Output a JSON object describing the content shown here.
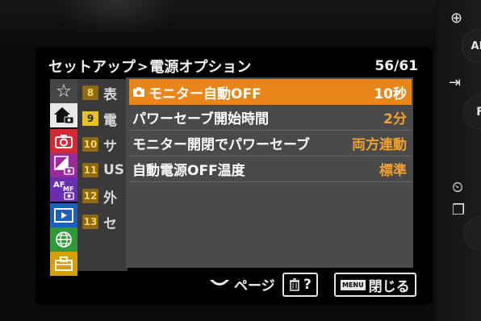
{
  "header": {
    "breadcrumb_parent": "セットアップ",
    "breadcrumb_separator": ">",
    "title": "電源オプション",
    "page_indicator": "56/61"
  },
  "categories": [
    {
      "name": "favorites",
      "icon": "star-icon"
    },
    {
      "name": "shooting",
      "icon": "home-camera-icon",
      "selected": true
    },
    {
      "name": "camera",
      "icon": "camera-icon"
    },
    {
      "name": "exposure",
      "icon": "exposure-camera-icon"
    },
    {
      "name": "af",
      "icon": "af-mf-camera-icon",
      "text": "AF MF"
    },
    {
      "name": "playback",
      "icon": "play-icon"
    },
    {
      "name": "network",
      "icon": "globe-icon"
    },
    {
      "name": "setup",
      "icon": "toolbox-icon"
    }
  ],
  "submenu": {
    "items": [
      {
        "num": "8",
        "text": "表"
      },
      {
        "num": "9",
        "text": "電",
        "active": true
      },
      {
        "num": "10",
        "text": "サ"
      },
      {
        "num": "11",
        "text": "US"
      },
      {
        "num": "12",
        "text": "外"
      },
      {
        "num": "13",
        "text": "セ"
      }
    ]
  },
  "menu": {
    "items": [
      {
        "label": "モニター自動OFF",
        "value": "10秒",
        "selected": true,
        "icon": "camera-icon"
      },
      {
        "label": "パワーセーブ開始時間",
        "value": "2分"
      },
      {
        "label": "モニター開閉でパワーセーブ",
        "value": "両方連動"
      },
      {
        "label": "自動電源OFF温度",
        "value": "標準"
      }
    ]
  },
  "hints": {
    "page_label": "ページ",
    "help_label": "?",
    "close_chip": "MENU",
    "close_label": "閉じる"
  },
  "camera_body": {
    "zoom_icon": "⊕",
    "af_label": "AF",
    "fn_label": "F"
  },
  "colors": {
    "selection": "#e8861b",
    "value": "#f0a030",
    "panel": "#4a4a4a"
  }
}
